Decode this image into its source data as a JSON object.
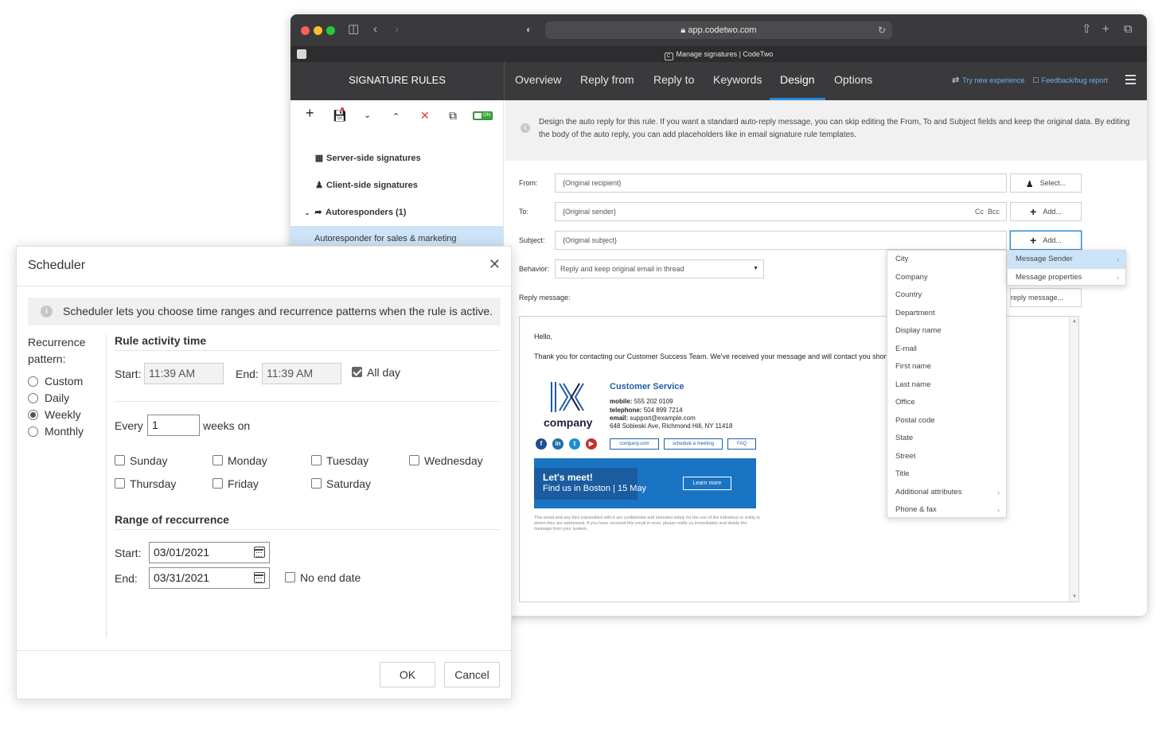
{
  "browser": {
    "url": "app.codetwo.com",
    "tab_title": "Manage signatures | CodeTwo"
  },
  "sidebar": {
    "title": "SIGNATURE RULES",
    "toggle_label": "ON",
    "items": [
      {
        "label": "Server-side signatures",
        "icon": "server-icon"
      },
      {
        "label": "Client-side signatures",
        "icon": "user-icon"
      },
      {
        "label": "Autoresponders (1)",
        "icon": "reply-arrow-icon"
      },
      {
        "label": "Autoresponder for sales & marketing"
      }
    ]
  },
  "tabs": [
    {
      "label": "Overview"
    },
    {
      "label": "Reply from"
    },
    {
      "label": "Reply to"
    },
    {
      "label": "Keywords"
    },
    {
      "label": "Design",
      "active": true
    },
    {
      "label": "Options"
    }
  ],
  "header_links": {
    "try_new": "Try new experience",
    "feedback": "Feedback/bug report"
  },
  "design": {
    "info": "Design the auto reply for this rule. If you want a standard auto-reply message, you can skip editing the From, To and Subject fields and keep the original data. By editing the body of the auto reply, you can add placeholders like in email signature rule templates.",
    "from_label": "From:",
    "from_value": "{Original recipient}",
    "select_btn": "Select...",
    "to_label": "To:",
    "to_value": "{Original sender}",
    "cc": "Cc",
    "bcc": "Bcc",
    "add_btn": "Add...",
    "subject_label": "Subject:",
    "subject_value": "{Original subject}",
    "behavior_label": "Behavior:",
    "behavior_value": "Reply and keep original email in thread",
    "reply_label": "Reply message:",
    "reply_btn": "reply message..."
  },
  "message": {
    "hello": "Hello,",
    "thanks": "Thank you for contacting our Customer Success Team. We've received your message and will contact you shor",
    "logo_text": "company",
    "cs_title": "Customer Service",
    "mobile_label": "mobile:",
    "mobile": "555 202 0109",
    "telephone_label": "telephone:",
    "telephone": "504 899 7214",
    "email_label": "email:",
    "email": "support@example.com",
    "address": "648 Sobieski Ave, Richmond Hill, NY 11418",
    "links": [
      "company.com",
      "schedule a meeting",
      "FAQ"
    ],
    "banner_title": "Let's meet!",
    "banner_sub": "Find us in Boston | 15 May",
    "banner_btn": "Learn more",
    "disclaimer": "This email and any files transmitted with it are confidential and intended solely for the use of the individual or entity to whom they are addressed. If you have received this email in error, please notify us immediately and delete the message from your system."
  },
  "placeholder_menu": {
    "items": [
      "City",
      "Company",
      "Country",
      "Department",
      "Display name",
      "E-mail",
      "First name",
      "Last name",
      "Office",
      "Postal code",
      "State",
      "Street",
      "Title",
      "Additional attributes",
      "Phone & fax"
    ]
  },
  "add_menu": {
    "items": [
      "Message Sender",
      "Message properties"
    ]
  },
  "scheduler": {
    "title": "Scheduler",
    "info": "Scheduler lets you choose time ranges and recurrence patterns when the rule is active.",
    "recurrence_label": "Recurrence pattern:",
    "patterns": [
      {
        "label": "Custom",
        "checked": false
      },
      {
        "label": "Daily",
        "checked": false
      },
      {
        "label": "Weekly",
        "checked": true
      },
      {
        "label": "Monthly",
        "checked": false
      }
    ],
    "activity_title": "Rule activity time",
    "start_label": "Start:",
    "start_time": "11:39 AM",
    "end_label": "End:",
    "end_time": "11:39 AM",
    "all_day": "All day",
    "all_day_checked": true,
    "every_label": "Every",
    "every_value": "1",
    "weeks_on": "weeks on",
    "days": [
      {
        "label": "Sunday",
        "checked": false
      },
      {
        "label": "Monday",
        "checked": false
      },
      {
        "label": "Tuesday",
        "checked": false
      },
      {
        "label": "Wednesday",
        "checked": false
      },
      {
        "label": "Thursday",
        "checked": false
      },
      {
        "label": "Friday",
        "checked": false
      },
      {
        "label": "Saturday",
        "checked": false
      }
    ],
    "range_title": "Range of reccurrence",
    "range_start_label": "Start:",
    "range_start": "03/01/2021",
    "range_end_label": "End:",
    "range_end": "03/31/2021",
    "no_end_date": "No end date",
    "ok": "OK",
    "cancel": "Cancel"
  }
}
